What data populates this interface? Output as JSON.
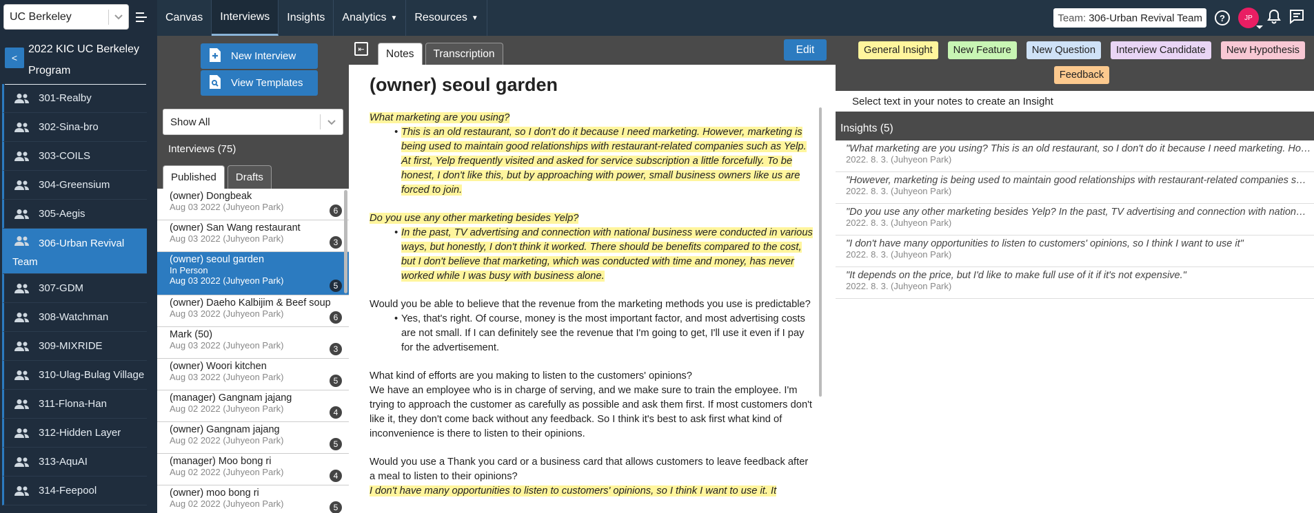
{
  "org": {
    "selected": "UC Berkeley"
  },
  "program": {
    "title": "2022 KIC UC Berkeley Program",
    "back_label": "<"
  },
  "teams": [
    {
      "label": "301-Realby"
    },
    {
      "label": "302-Sina-bro"
    },
    {
      "label": "303-COILS"
    },
    {
      "label": "304-Greensium"
    },
    {
      "label": "305-Aegis"
    },
    {
      "label": "306-Urban Revival",
      "label2": "Team",
      "active": true
    },
    {
      "label": "307-GDM"
    },
    {
      "label": "308-Watchman"
    },
    {
      "label": "309-MIXRIDE"
    },
    {
      "label": "310-Ulag-Bulag Village"
    },
    {
      "label": "311-Flona-Han"
    },
    {
      "label": "312-Hidden Layer"
    },
    {
      "label": "313-AquAI"
    },
    {
      "label": "314-Feepool"
    }
  ],
  "nav": {
    "canvas": "Canvas",
    "interviews": "Interviews",
    "insights": "Insights",
    "analytics": "Analytics",
    "resources": "Resources"
  },
  "topright": {
    "team_key": "Team:",
    "team_value": "306-Urban Revival Team",
    "help": "?",
    "avatar": "JP"
  },
  "interviews": {
    "new_button": "New Interview",
    "templates_button": "View Templates",
    "filter": "Show All",
    "count_label": "Interviews (75)",
    "tab_published": "Published",
    "tab_drafts": "Drafts",
    "items": [
      {
        "name": "(owner) Dongbeak",
        "meta": "Aug 03 2022 (Juhyeon Park)",
        "count": "6"
      },
      {
        "name": "(owner) San Wang restaurant",
        "meta": "Aug 03 2022 (Juhyeon Park)",
        "count": "3"
      },
      {
        "name": "(owner) seoul garden",
        "sub": "In Person",
        "meta": "Aug 03 2022 (Juhyeon Park)",
        "count": "5",
        "active": true
      },
      {
        "name": "(owner) Daeho Kalbijim & Beef soup",
        "meta": "Aug 03 2022 (Juhyeon Park)",
        "count": "6"
      },
      {
        "name": "Mark (50)",
        "meta": "Aug 03 2022 (Juhyeon Park)",
        "count": "3"
      },
      {
        "name": "(owner) Woori kitchen",
        "meta": "Aug 03 2022 (Juhyeon Park)",
        "count": "5"
      },
      {
        "name": "(manager) Gangnam jajang",
        "meta": "Aug 02 2022 (Juhyeon Park)",
        "count": "4"
      },
      {
        "name": "(owner) Gangnam jajang",
        "meta": "Aug 02 2022 (Juhyeon Park)",
        "count": "5"
      },
      {
        "name": "(manager) Moo bong ri",
        "meta": "Aug 02 2022 (Juhyeon Park)",
        "count": "4"
      },
      {
        "name": "(owner) moo bong ri",
        "meta": "Aug 02 2022 (Juhyeon Park)",
        "count": "5"
      }
    ]
  },
  "notes": {
    "tab_notes": "Notes",
    "tab_transcription": "Transcription",
    "edit": "Edit",
    "title": "(owner) seoul garden",
    "q1": "What marketing are you using?",
    "a1": "This is an old restaurant, so I don't do it because I need marketing. However, marketing is being used to maintain good relationships with restaurant-related companies such as Yelp. At first, Yelp frequently visited and asked for service subscription a little forcefully. To be honest, I don't like this, but by approaching with power, small business owners like us are forced to join.",
    "q2": "Do you use any other marketing besides Yelp?",
    "a2": "In the past, TV advertising and connection with national business were conducted in various ways, but honestly, I don't think it worked. There should be benefits compared to the cost, but I don't believe that marketing, which was conducted with time and money, has never worked while I was busy with business alone.",
    "q3": "Would you be able to believe that the revenue from the marketing methods you use is predictable?",
    "a3": "Yes, that's right. Of course, money is the most important factor, and most advertising costs are not small. If I can definitely see the revenue that I'm going to get, I'll use it even if I pay for the advertisement.",
    "q4": "What kind of efforts are you making to listen to the customers' opinions?",
    "a4": "We have an employee who is in charge of serving, and we make sure to train the employee. I'm trying to approach the customer as carefully as possible and ask them first. If most customers don't like it, they don't come back without any feedback. So I think it's best to ask first what kind of inconvenience is there to listen to their opinions.",
    "q5": "Would you use a Thank you card or a business card that allows customers to leave feedback after a meal to listen to their opinions?",
    "a5": "I don't have many opportunities to listen to customers' opinions, so I think I want to use it. It"
  },
  "insights": {
    "tags": [
      {
        "label": "General Insight",
        "color": "#fff59d"
      },
      {
        "label": "New Feature",
        "color": "#c8f5b4"
      },
      {
        "label": "New Question",
        "color": "#cfe2f7"
      },
      {
        "label": "Interview Candidate",
        "color": "#e9d5f5"
      },
      {
        "label": "New Hypothesis",
        "color": "#f8c8d4"
      },
      {
        "label": "Feedback",
        "color": "#fcc98e"
      }
    ],
    "hint": "Select text in your notes to create an Insight",
    "header": "Insights (5)",
    "items": [
      {
        "text": "\"What marketing are you using? This is an old restaurant, so I don't do it because I need marketing. However, marketing is being used",
        "date": "2022. 8. 3. (Juhyeon Park)"
      },
      {
        "text": "\"However, marketing is being used to maintain good relationships with restaurant-related companies such as Yelp.\"",
        "date": "2022. 8. 3. (Juhyeon Park)"
      },
      {
        "text": "\"Do you use any other marketing besides Yelp? In the past, TV advertising and connection with national business were conducted\"",
        "date": "2022. 8. 3. (Juhyeon Park)"
      },
      {
        "text": "\"I don't have many opportunities to listen to customers' opinions, so I think I want to use it\"",
        "date": "2022. 8. 3. (Juhyeon Park)"
      },
      {
        "text": "\"It depends on the price, but I'd like to make full use of it if it's not expensive.\"",
        "date": "2022. 8. 3. (Juhyeon Park)"
      }
    ]
  }
}
